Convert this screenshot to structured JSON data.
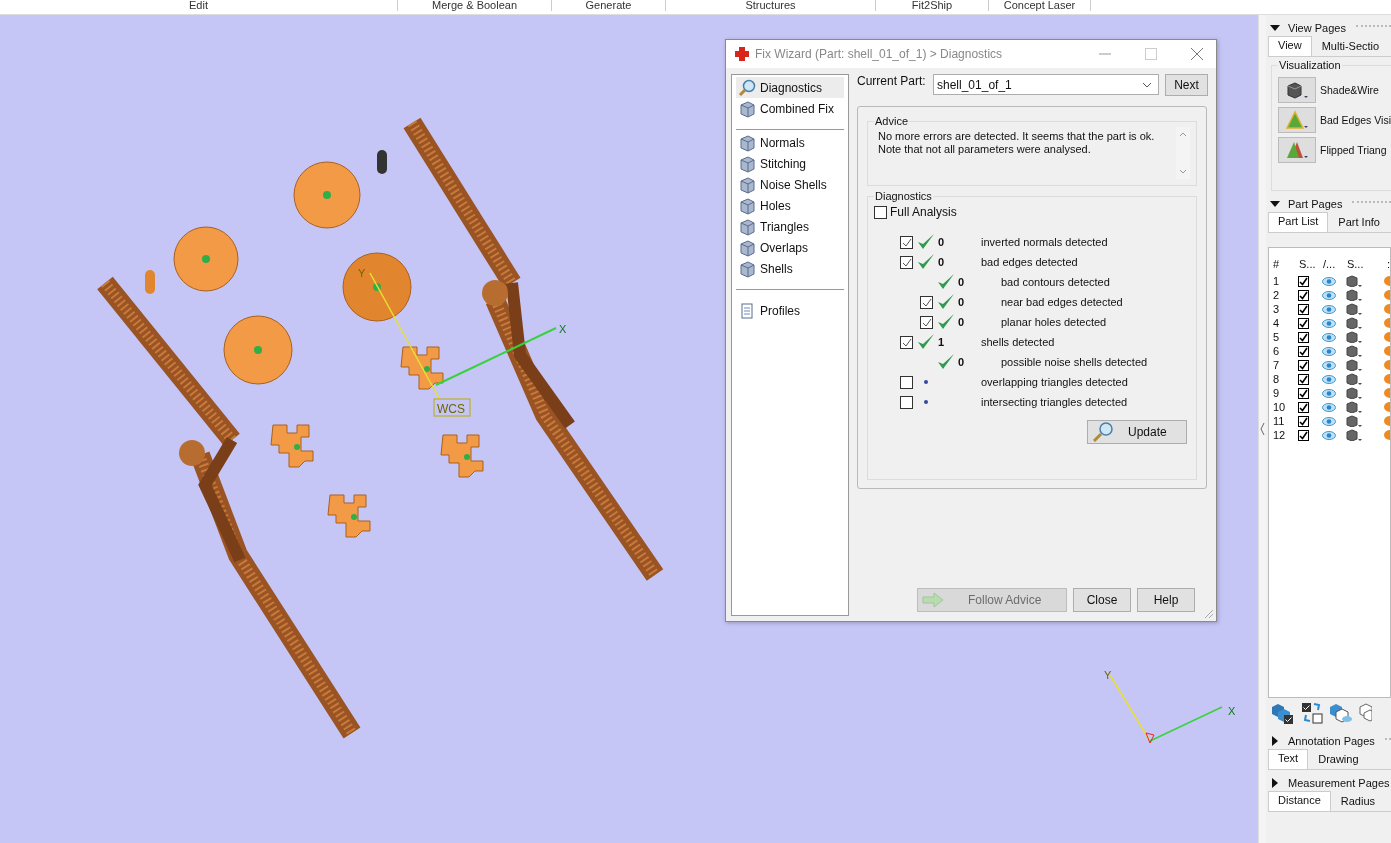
{
  "menu_bar": [
    "Edit",
    "Merge & Boolean",
    "Generate",
    "Structures",
    "Fit2Ship",
    "Concept Laser"
  ],
  "viewport": {
    "wcs_label": "WCS",
    "main_axes": [
      {
        "label": "Y"
      },
      {
        "label": "X"
      }
    ],
    "corner_axes": [
      {
        "label": "Y"
      },
      {
        "label": "X"
      }
    ]
  },
  "dialog": {
    "title": "Fix Wizard (Part: shell_01_of_1) > Diagnostics",
    "sidebar_groups": [
      {
        "items": [
          {
            "label": "Diagnostics",
            "kind": "search",
            "selected": true
          },
          {
            "label": "Combined Fix",
            "kind": "cube",
            "selected": false
          }
        ]
      },
      {
        "items": [
          {
            "label": "Normals",
            "kind": "cube",
            "selected": false
          },
          {
            "label": "Stitching",
            "kind": "cube",
            "selected": false
          },
          {
            "label": "Noise Shells",
            "kind": "cube",
            "selected": false
          },
          {
            "label": "Holes",
            "kind": "cube",
            "selected": false
          },
          {
            "label": "Triangles",
            "kind": "cube",
            "selected": false
          },
          {
            "label": "Overlaps",
            "kind": "cube",
            "selected": false
          },
          {
            "label": "Shells",
            "kind": "cube",
            "selected": false
          }
        ]
      },
      {
        "items": [
          {
            "label": "Profiles",
            "kind": "document",
            "selected": false
          }
        ]
      }
    ],
    "current_part_label": "Current Part:",
    "current_part_value": "shell_01_of_1",
    "next_button": "Next",
    "advice": {
      "title": "Advice",
      "text": "No more errors are detected. It seems that the part is ok.\nNote that not all parameters were analysed."
    },
    "diagnostics": {
      "title": "Diagnostics",
      "full_analysis": {
        "label": "Full Analysis",
        "checked": false
      },
      "rows": [
        {
          "kind": "checkbox",
          "checked": true,
          "passed": true,
          "count": "0",
          "label": "inverted normals detected"
        },
        {
          "kind": "checkbox",
          "checked": true,
          "passed": true,
          "count": "0",
          "label": "bad edges detected",
          "children": [
            {
              "kind": "plain",
              "passed": true,
              "count": "0",
              "label": "bad contours detected"
            },
            {
              "kind": "checkbox",
              "checked": true,
              "passed": true,
              "count": "0",
              "label": "near bad edges detected"
            },
            {
              "kind": "checkbox",
              "checked": true,
              "passed": true,
              "count": "0",
              "label": "planar holes detected"
            }
          ]
        },
        {
          "kind": "checkbox",
          "checked": true,
          "passed": true,
          "count": "1",
          "label": "shells detected",
          "children": [
            {
              "kind": "plain",
              "passed": true,
              "count": "0",
              "label": "possible noise shells detected"
            }
          ]
        },
        {
          "kind": "checkbox",
          "checked": false,
          "passed": false,
          "label": "overlapping triangles detected"
        },
        {
          "kind": "checkbox",
          "checked": false,
          "passed": false,
          "label": "intersecting triangles detected"
        }
      ]
    },
    "update_button": "Update",
    "buttons": [
      {
        "label": "Follow Advice",
        "disabled": true,
        "kind": "arrow"
      },
      {
        "label": "Close",
        "disabled": false,
        "kind": "plain"
      },
      {
        "label": "Help",
        "disabled": false,
        "kind": "plain"
      }
    ]
  },
  "right_panel": {
    "view_pages": {
      "title": "View Pages",
      "expanded": true,
      "tabs": [
        {
          "label": "View",
          "selected": true
        },
        {
          "label": "Multi-Sectio",
          "selected": false
        }
      ],
      "group_title": "Visualization",
      "tools": [
        {
          "label": "Shade&Wire",
          "kind": "cube"
        },
        {
          "label": "Bad Edges Visi",
          "kind": "triangle"
        },
        {
          "label": "Flipped Triang",
          "kind": "triangles"
        }
      ]
    },
    "part_pages": {
      "title": "Part Pages",
      "expanded": true,
      "tabs": [
        {
          "label": "Part List",
          "selected": true
        },
        {
          "label": "Part Info",
          "selected": false
        }
      ],
      "columns": [
        "#",
        "S...",
        "/...",
        "S...",
        ":"
      ],
      "rows": [
        {
          "number": "1",
          "checked": true
        },
        {
          "number": "2",
          "checked": true
        },
        {
          "number": "3",
          "checked": true
        },
        {
          "number": "4",
          "checked": true
        },
        {
          "number": "5",
          "checked": true
        },
        {
          "number": "6",
          "checked": true
        },
        {
          "number": "7",
          "checked": true
        },
        {
          "number": "8",
          "checked": true
        },
        {
          "number": "9",
          "checked": true
        },
        {
          "number": "10",
          "checked": true
        },
        {
          "number": "11",
          "checked": true
        },
        {
          "number": "12",
          "checked": true
        }
      ]
    },
    "annotation_pages": {
      "title": "Annotation Pages",
      "expanded": false,
      "tabs": [
        {
          "label": "Text",
          "selected": true
        },
        {
          "label": "Drawing",
          "selected": false
        }
      ]
    },
    "measurement_pages": {
      "title": "Measurement Pages",
      "expanded": false,
      "tabs": [
        {
          "label": "Distance",
          "selected": true
        },
        {
          "label": "Radius",
          "selected": false
        }
      ]
    }
  }
}
